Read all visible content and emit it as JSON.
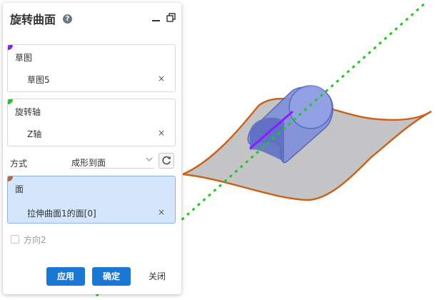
{
  "panel": {
    "title": "旋转曲面",
    "help_glyph": "?",
    "sketch": {
      "label": "草图",
      "value": "草图5",
      "clear": "×",
      "marker_color": "#8a1cff"
    },
    "axis": {
      "label": "旋转轴",
      "value": "Z轴",
      "clear": "×",
      "marker_color": "#1ec81e"
    },
    "mode": {
      "label": "方式",
      "selected": "成形到面"
    },
    "face": {
      "label": "面",
      "value": "拉伸曲面1的面[0]",
      "clear": "×",
      "marker_color": "#c8641e"
    },
    "direction2": {
      "label": "方向2",
      "checked": false
    },
    "buttons": {
      "apply": "应用",
      "ok": "确定",
      "close": "关闭"
    }
  },
  "colors": {
    "primary_button": "#1a78d4",
    "active_section": "#d4e6fb",
    "surface_edge": "#c8641e",
    "axis_line": "#1ec81e",
    "cylinder": "#6b7fcf",
    "sketch_line": "#8a1cff"
  },
  "icons": [
    "help-icon",
    "minimize-icon",
    "restore-icon",
    "clear-icon",
    "chevron-down-icon",
    "refresh-icon",
    "checkbox-icon"
  ]
}
